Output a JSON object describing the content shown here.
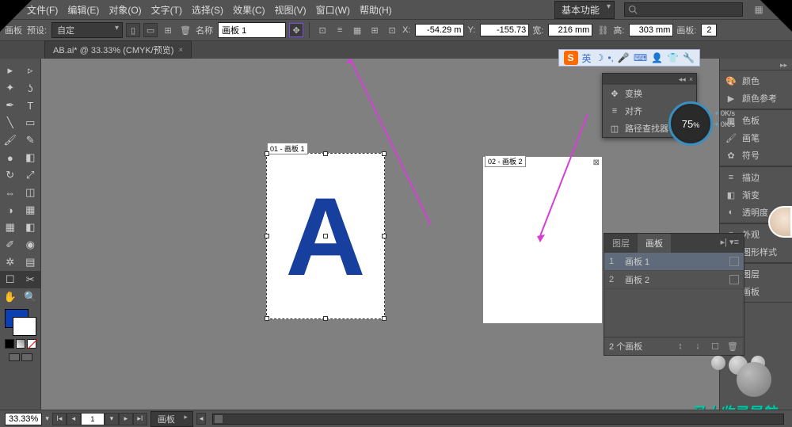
{
  "menu": {
    "items": [
      "文件(F)",
      "编辑(E)",
      "对象(O)",
      "文字(T)",
      "选择(S)",
      "效果(C)",
      "视图(V)",
      "窗口(W)",
      "帮助(H)"
    ],
    "workspace": "基本功能"
  },
  "ctrl": {
    "title": "画板",
    "preset_label": "预设:",
    "preset_value": "自定",
    "name_label": "名称",
    "name_value": "画板 1",
    "x_label": "X:",
    "x_value": "-54.29 m",
    "y_label": "Y:",
    "y_value": "-155.73",
    "w_label": "宽:",
    "w_value": "216 mm",
    "h_label": "高:",
    "h_value": "303 mm",
    "artboards_label": "画板:",
    "artboards_value": "2"
  },
  "doc": {
    "tab": "AB.ai* @ 33.33% (CMYK/预览)"
  },
  "ab": {
    "label1": "01 - 画板 1",
    "label2": "02 - 画板 2",
    "letter": "A"
  },
  "sogou": {
    "text": "英"
  },
  "gauge": {
    "value": "75",
    "unit": "%",
    "up": "0K/s",
    "down": "0K/s"
  },
  "transform_panel": {
    "items": [
      "变换",
      "对齐",
      "路径查找器"
    ]
  },
  "abpanel": {
    "tab_layers": "图层",
    "tab_artboards": "画板",
    "items": [
      {
        "n": "1",
        "name": "画板 1"
      },
      {
        "n": "2",
        "name": "画板 2"
      }
    ],
    "foot": "2 个画板"
  },
  "rdock": {
    "g1": [
      "颜色",
      "颜色参考"
    ],
    "g2": [
      "色板",
      "画笔",
      "符号"
    ],
    "g3": [
      "描边",
      "渐变",
      "透明度"
    ],
    "g4": [
      "外观",
      "图形样式"
    ],
    "g5": [
      "图层",
      "画板"
    ]
  },
  "status": {
    "zoom": "33.33%",
    "page": "1",
    "tool": "画板"
  },
  "watermark": "马上收录导航"
}
